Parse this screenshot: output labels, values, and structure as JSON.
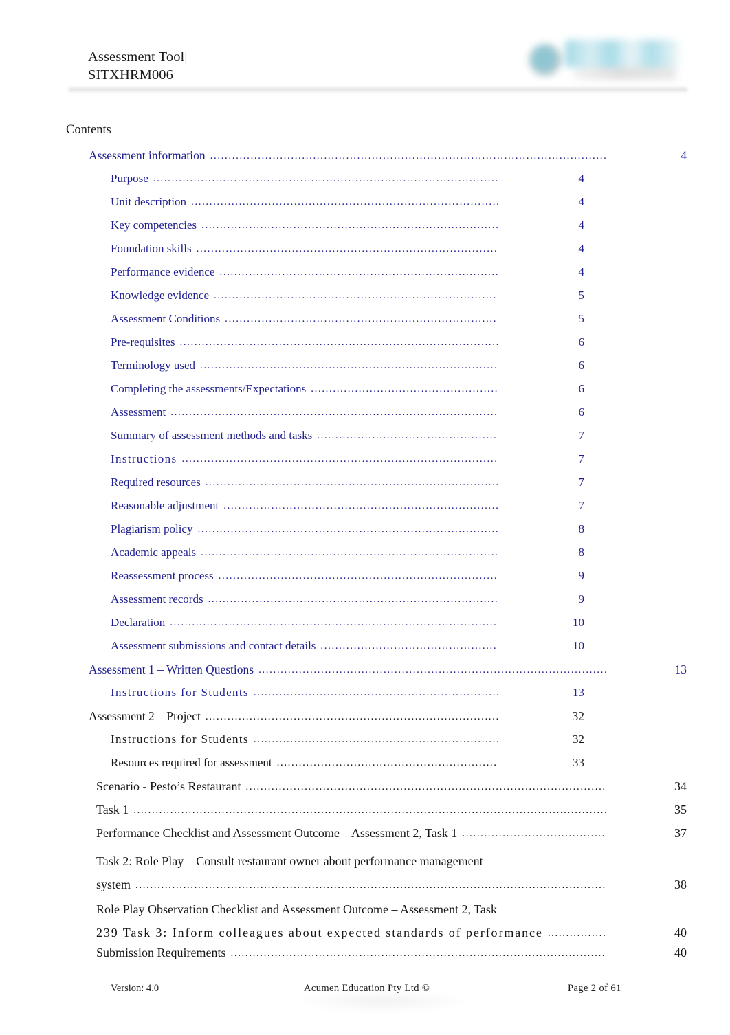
{
  "header": {
    "title_line1": "Assessment Tool|",
    "title_line2": "SITXHRM006",
    "logo_alt": "Acumen Education logo"
  },
  "contents": {
    "heading": "Contents",
    "accent_blue": "#1F1F8F",
    "text_black": "#161616",
    "entries": [
      {
        "label": "Assessment      information",
        "page": "4",
        "level": 1,
        "color": "blue"
      },
      {
        "label": "Purpose",
        "page": "4",
        "level": 2,
        "color": "blue"
      },
      {
        "label": "Unit  description",
        "page": "4",
        "level": 2,
        "color": "blue"
      },
      {
        "label": "Key  competencies",
        "page": "4",
        "level": 2,
        "color": "blue"
      },
      {
        "label": "Foundation    skills",
        "page": "4",
        "level": 2,
        "color": "blue"
      },
      {
        "label": "Performance      evidence",
        "page": "4",
        "level": 2,
        "color": "blue"
      },
      {
        "label": "Knowledge    evidence",
        "page": "5",
        "level": 2,
        "color": "blue"
      },
      {
        "label": "Assessment      Conditions",
        "page": "5",
        "level": 2,
        "color": "blue"
      },
      {
        "label": "Pre-requisites",
        "page": "6",
        "level": 2,
        "color": "blue"
      },
      {
        "label": "Terminology     used",
        "page": "6",
        "level": 2,
        "color": "blue"
      },
      {
        "label": "Completing    the   assessments/Expectations",
        "page": "6",
        "level": 2,
        "color": "blue"
      },
      {
        "label": "Assessment",
        "page": "6",
        "level": 2,
        "color": "blue"
      },
      {
        "label": "Summary   of assessment     methods    and   tasks",
        "page": "7",
        "level": 2,
        "color": "blue"
      },
      {
        "label": "Instructions",
        "page": "7",
        "level": 2,
        "color": "blue",
        "spacing": "wide"
      },
      {
        "label": "Required   resources",
        "page": "7",
        "level": 2,
        "color": "blue"
      },
      {
        "label": "Reasonable     adjustment",
        "page": "7",
        "level": 2,
        "color": "blue"
      },
      {
        "label": "Plagiarism   policy",
        "page": "8",
        "level": 2,
        "color": "blue"
      },
      {
        "label": "Academic    appeals",
        "page": "8",
        "level": 2,
        "color": "blue"
      },
      {
        "label": "Reassessment       process",
        "page": "9",
        "level": 2,
        "color": "blue"
      },
      {
        "label": "Assessment    records",
        "page": "9",
        "level": 2,
        "color": "blue"
      },
      {
        "label": "Declaration",
        "page": "10",
        "level": 2,
        "color": "blue"
      },
      {
        "label": "Assessment     submissions    and  contact   details",
        "page": "10",
        "level": 2,
        "color": "blue"
      },
      {
        "label": "Assessment     1 – Written   Questions",
        "page": "13",
        "level": 1,
        "color": "blue"
      },
      {
        "label": "Instructions for Students",
        "page": "13",
        "level": 2,
        "color": "blue",
        "spacing": "wide"
      },
      {
        "label": "Assessment 2 – Project",
        "page": "32",
        "level": 1,
        "color": "black"
      },
      {
        "label": "Instructions for Students",
        "page": "32",
        "level": 2,
        "color": "black",
        "spacing": "wide"
      },
      {
        "label": "Resources required for assessment",
        "page": "33",
        "level": 2,
        "color": "black"
      },
      {
        "label": "Scenario - Pesto’s Restaurant",
        "page": "34",
        "level": "S",
        "color": "black"
      },
      {
        "label": "Task 1",
        "page": "35",
        "level": "S",
        "color": "black"
      },
      {
        "label": "Performance Checklist and Assessment Outcome – Assessment 2, Task 1",
        "page": "37",
        "level": "S",
        "color": "black"
      },
      {
        "label_line1": "Task 2: Role Play – Consult restaurant owner about performance management",
        "label_line2": "system",
        "page": "38",
        "level": "S",
        "color": "black",
        "two_line": true
      },
      {
        "label_line1": "Role Play Observation Checklist and Assessment Outcome – Assessment 2, Task",
        "label_line2": "239 Task 3: Inform colleagues about expected standards of performance",
        "page": "40",
        "level": "S",
        "color": "black",
        "two_line": true,
        "spacing2": "xwide"
      },
      {
        "label": "Submission Requirements",
        "page": "40",
        "level": "S",
        "color": "black"
      }
    ],
    "leader_dots": "................................................................................................................................................................"
  },
  "footer": {
    "version": "Version: 4.0",
    "center": "Acumen   Education   Pty  Ltd  ©",
    "page": "Page 2   of  61"
  }
}
